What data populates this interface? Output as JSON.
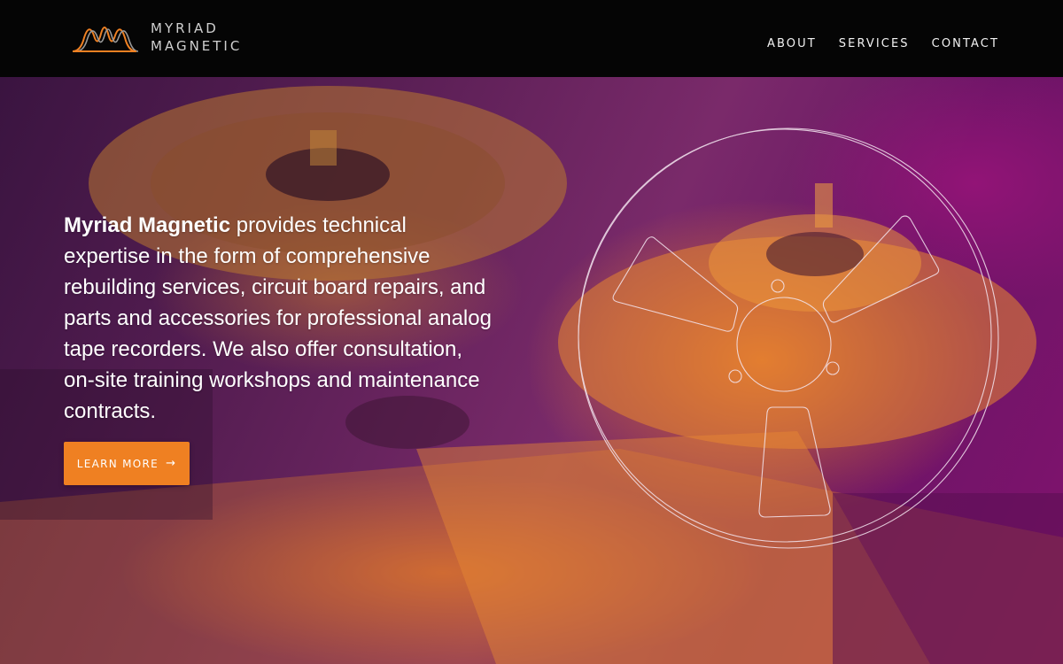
{
  "brand": {
    "line1": "MYRIAD",
    "line2": "MAGNETIC",
    "logo_icon": "waveform-logo-icon",
    "logo_colors": [
      "#ef8022",
      "#9a9a9a"
    ]
  },
  "nav": {
    "items": [
      {
        "label": "ABOUT"
      },
      {
        "label": "SERVICES"
      },
      {
        "label": "CONTACT"
      }
    ]
  },
  "hero": {
    "lead": "Myriad Magnetic",
    "body": " provides technical expertise in the form of comprehensive rebuilding services, circuit board repairs, and parts and accessories for professional analog tape recorders. We also offer consultation, on-site training workshops and maintenance contracts.",
    "cta_label": "LEARN MORE",
    "cta_icon": "arrow-right-icon",
    "background_icon": "tape-reel-outline-icon"
  },
  "colors": {
    "accent": "#ef8022",
    "header_bg": "#050505",
    "overlay_purple": "#7a1a6e"
  }
}
